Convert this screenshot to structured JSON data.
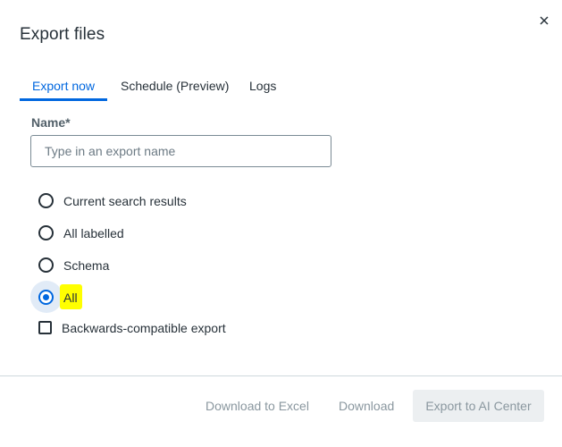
{
  "dialog": {
    "title": "Export files",
    "close_icon": "close-icon"
  },
  "tabs": [
    {
      "label": "Export now",
      "active": true
    },
    {
      "label": "Schedule (Preview)",
      "active": false
    },
    {
      "label": "Logs",
      "active": false
    }
  ],
  "form": {
    "name_label": "Name*",
    "name_placeholder": "Type in an export name",
    "name_value": ""
  },
  "options": [
    {
      "label": "Current search results",
      "selected": false
    },
    {
      "label": "All labelled",
      "selected": false
    },
    {
      "label": "Schema",
      "selected": false
    },
    {
      "label": "All",
      "selected": true
    }
  ],
  "backwards_compatible": {
    "label": "Backwards-compatible export",
    "checked": false
  },
  "footer": {
    "download_excel": "Download to Excel",
    "download": "Download",
    "export_ai_center": "Export to AI Center"
  },
  "colors": {
    "accent": "#0067df",
    "highlight": "#ffff00",
    "text": "#273139",
    "disabled": "#8a979f"
  }
}
